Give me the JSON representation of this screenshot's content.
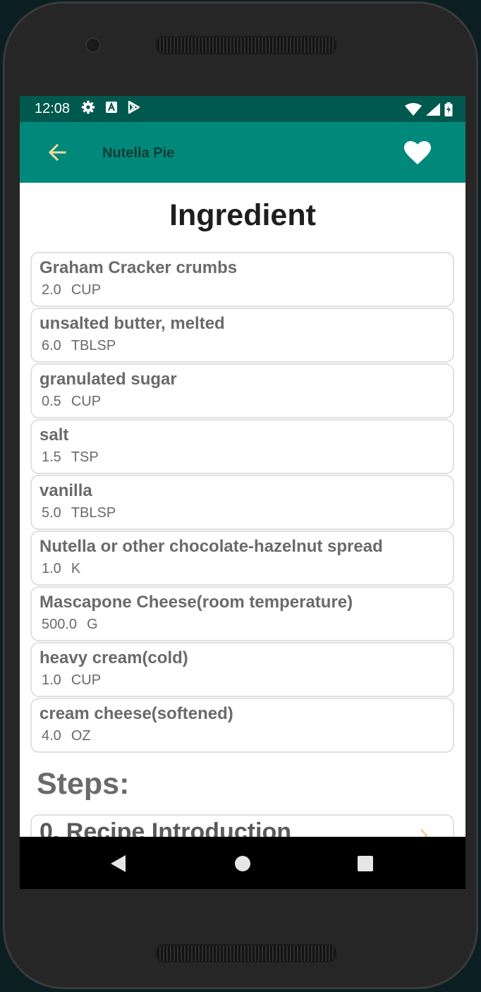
{
  "status_bar": {
    "time": "12:08",
    "icons": [
      "settings-icon",
      "a-icon",
      "play-store-icon",
      "wifi-icon",
      "signal-icon",
      "battery-icon"
    ]
  },
  "app_bar": {
    "title": "Nutella Pie",
    "color": "#00897b",
    "status_color": "#00594e",
    "back_icon_color": "#f3d9a3"
  },
  "ingredients": {
    "heading": "Ingredient",
    "items": [
      {
        "name": "Graham Cracker crumbs",
        "quantity": "2.0",
        "unit": "CUP"
      },
      {
        "name": "unsalted butter, melted",
        "quantity": "6.0",
        "unit": "TBLSP"
      },
      {
        "name": "granulated sugar",
        "quantity": "0.5",
        "unit": "CUP"
      },
      {
        "name": "salt",
        "quantity": "1.5",
        "unit": "TSP"
      },
      {
        "name": "vanilla",
        "quantity": "5.0",
        "unit": "TBLSP"
      },
      {
        "name": "Nutella or other chocolate-hazelnut spread",
        "quantity": "1.0",
        "unit": "K"
      },
      {
        "name": "Mascapone Cheese(room temperature)",
        "quantity": "500.0",
        "unit": "G"
      },
      {
        "name": "heavy cream(cold)",
        "quantity": "1.0",
        "unit": "CUP"
      },
      {
        "name": "cream cheese(softened)",
        "quantity": "4.0",
        "unit": "OZ"
      }
    ]
  },
  "steps": {
    "heading": "Steps:",
    "items": [
      {
        "title": "0. Recipe Introduction"
      }
    ]
  }
}
